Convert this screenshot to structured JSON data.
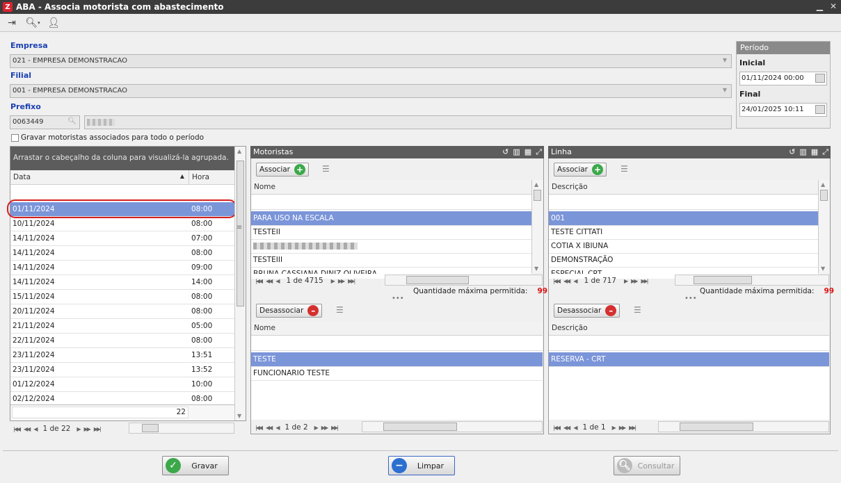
{
  "window": {
    "title": "ABA - Associa motorista com abastecimento",
    "app_icon": "Z"
  },
  "form": {
    "empresa_label": "Empresa",
    "empresa_value": "021 - EMPRESA DEMONSTRACAO",
    "filial_label": "Filial",
    "filial_value": "001 - EMPRESA DEMONSTRACAO",
    "prefixo_label": "Prefixo",
    "prefixo_value": "0063449",
    "gravar_label": "Gravar motoristas associados para todo o período"
  },
  "periodo": {
    "title": "Período",
    "inicial_label": "Inicial",
    "inicial_value": "01/11/2024 00:00",
    "final_label": "Final",
    "final_value": "24/01/2025 10:11"
  },
  "abastecimentos": {
    "group_hint": "Arrastar o cabeçalho da coluna para visualizá-la agrupada.",
    "col_data": "Data",
    "col_hora": "Hora",
    "rows": [
      {
        "data": "01/11/2024",
        "hora": "08:00"
      },
      {
        "data": "10/11/2024",
        "hora": "08:00"
      },
      {
        "data": "14/11/2024",
        "hora": "07:00"
      },
      {
        "data": "14/11/2024",
        "hora": "08:00"
      },
      {
        "data": "14/11/2024",
        "hora": "09:00"
      },
      {
        "data": "14/11/2024",
        "hora": "14:00"
      },
      {
        "data": "15/11/2024",
        "hora": "08:00"
      },
      {
        "data": "20/11/2024",
        "hora": "08:00"
      },
      {
        "data": "21/11/2024",
        "hora": "05:00"
      },
      {
        "data": "22/11/2024",
        "hora": "08:00"
      },
      {
        "data": "23/11/2024",
        "hora": "13:51"
      },
      {
        "data": "23/11/2024",
        "hora": "13:52"
      },
      {
        "data": "01/12/2024",
        "hora": "10:00"
      },
      {
        "data": "02/12/2024",
        "hora": "08:00"
      }
    ],
    "footer_count": "22",
    "pager": "1 de 22"
  },
  "motoristas": {
    "title": "Motoristas",
    "associar_label": "Associar",
    "col_nome": "Nome",
    "rows": [
      "PARA USO NA ESCALA",
      "TESTEII",
      "",
      "TESTEIII",
      "BRUNA CASSIANA DINIZ OLIVEIRA"
    ],
    "pager": "1 de 4715",
    "qty_label": "Quantidade máxima permitida:",
    "qty_value": "99",
    "desassociar_label": "Desassociar",
    "col_nome2": "Nome",
    "assoc_rows": [
      "TESTE",
      "FUNCIONARIO TESTE"
    ],
    "pager2": "1 de 2"
  },
  "linha": {
    "title": "Linha",
    "associar_label": "Associar",
    "col_desc": "Descrição",
    "rows": [
      "001",
      "TESTE CITTATI",
      "COTIA X IBIUNA",
      "DEMONSTRAÇÃO",
      "ESPECIAL CRT"
    ],
    "pager": "1 de 717",
    "qty_label": "Quantidade máxima permitida:",
    "qty_value": "99",
    "desassociar_label": "Desassociar",
    "col_desc2": "Descrição",
    "assoc_rows": [
      "RESERVA - CRT"
    ],
    "pager2": "1 de 1"
  },
  "actions": {
    "gravar": "Gravar",
    "limpar": "Limpar",
    "consultar": "Consultar"
  }
}
